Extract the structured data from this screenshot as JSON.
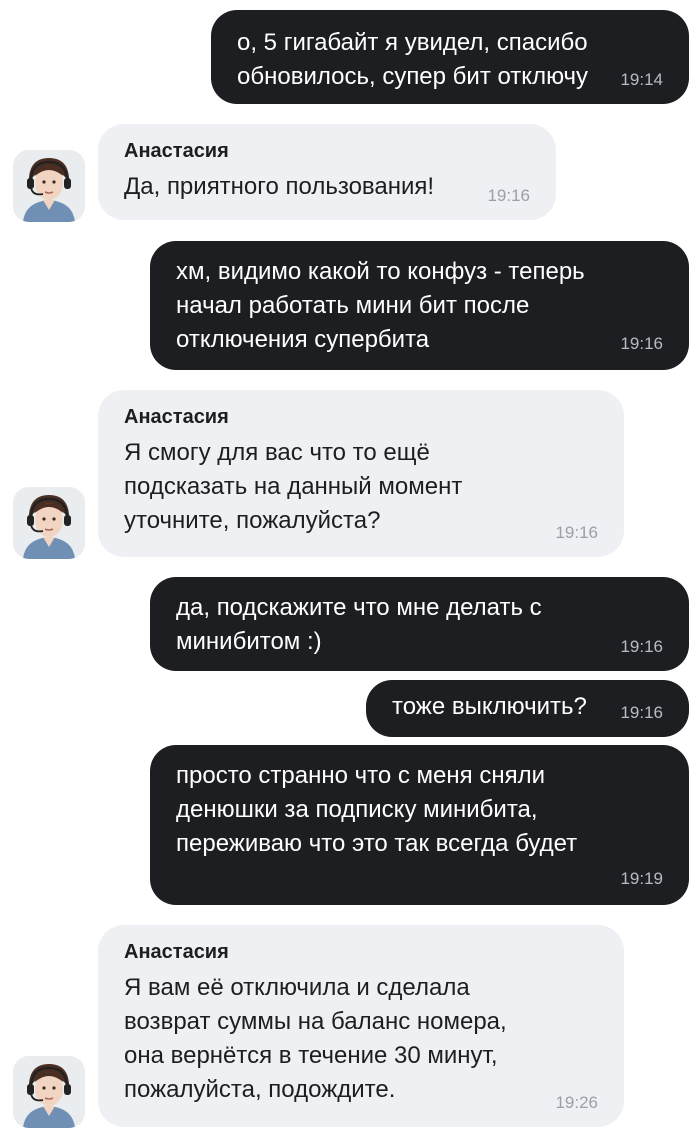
{
  "messages": [
    {
      "dir": "out",
      "text": "о, 5 гигабайт я увидел, спасибо\nобновилось, супер бит отключу",
      "time": "19:14"
    },
    {
      "dir": "in",
      "sender": "Анастасия",
      "text": "Да, приятного пользования!",
      "time": "19:16"
    },
    {
      "dir": "out",
      "text": "хм, видимо какой то конфуз - теперь\nначал работать мини бит после\nотключения супербита",
      "time": "19:16"
    },
    {
      "dir": "in",
      "sender": "Анастасия",
      "text": "Я смогу для вас что то ещё\nподсказать на данный момент\nуточните, пожалуйста?",
      "time": "19:16"
    },
    {
      "dir": "out",
      "text": "да, подскажите что мне делать с\nминибитом :)",
      "time": "19:16"
    },
    {
      "dir": "out",
      "text": "тоже выключить?",
      "time": "19:16"
    },
    {
      "dir": "out",
      "text": "просто странно что с меня сняли\nденюшки за подписку минибита,\nпереживаю что это так всегда будет",
      "time": "19:19"
    },
    {
      "dir": "in",
      "sender": "Анастасия",
      "text": "Я вам её отключила и сделала\nвозврат суммы на баланс номера,\nона вернётся в течение 30 минут,\nпожалуйста, подождите.",
      "time": "19:26"
    }
  ],
  "icons": {
    "avatar": "operator-avatar-icon"
  },
  "colors": {
    "outgoing_bg": "#1c1e21",
    "incoming_bg": "#eef0f3",
    "time": "#9aa0a6"
  }
}
